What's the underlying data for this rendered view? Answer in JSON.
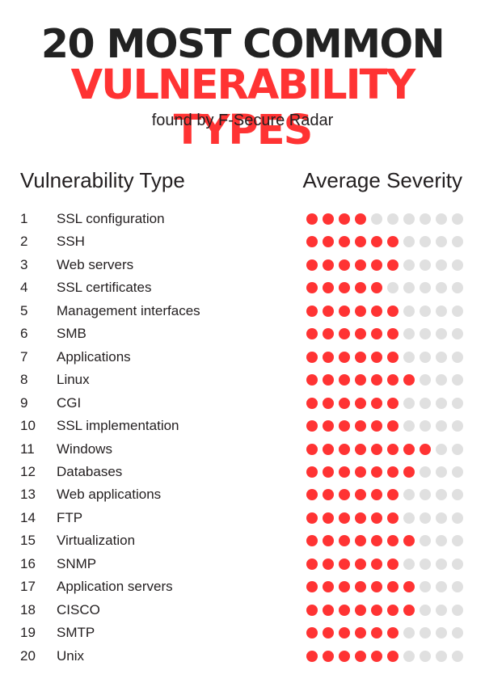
{
  "header": {
    "title_line1": "20 MOST COMMON",
    "title_line2": "VULNERABILITY TYPES",
    "subtitle": "found by F-Secure Radar"
  },
  "colors": {
    "accent": "#ff3333",
    "inactive": "#e0e0e0",
    "text": "#231f20"
  },
  "chart_data": {
    "type": "table",
    "title": "20 MOST COMMON VULNERABILITY TYPES",
    "subtitle": "found by F-Secure Radar",
    "columns": [
      "Vulnerability Type",
      "Average Severity"
    ],
    "scale_max": 10,
    "rows": [
      {
        "rank": "1",
        "type": "SSL configuration",
        "severity": 4
      },
      {
        "rank": "2",
        "type": "SSH",
        "severity": 6
      },
      {
        "rank": "3",
        "type": "Web servers",
        "severity": 6
      },
      {
        "rank": "4",
        "type": "SSL certificates",
        "severity": 5
      },
      {
        "rank": "5",
        "type": "Management interfaces",
        "severity": 6
      },
      {
        "rank": "6",
        "type": "SMB",
        "severity": 6
      },
      {
        "rank": "7",
        "type": "Applications",
        "severity": 6
      },
      {
        "rank": "8",
        "type": "Linux",
        "severity": 7
      },
      {
        "rank": "9",
        "type": "CGI",
        "severity": 6
      },
      {
        "rank": "10",
        "type": "SSL implementation",
        "severity": 6
      },
      {
        "rank": "11",
        "type": "Windows",
        "severity": 8
      },
      {
        "rank": "12",
        "type": "Databases",
        "severity": 7
      },
      {
        "rank": "13",
        "type": "Web applications",
        "severity": 6
      },
      {
        "rank": "14",
        "type": "FTP",
        "severity": 6
      },
      {
        "rank": "15",
        "type": "Virtualization",
        "severity": 7
      },
      {
        "rank": "16",
        "type": "SNMP",
        "severity": 6
      },
      {
        "rank": "17",
        "type": "Application servers",
        "severity": 7
      },
      {
        "rank": "18",
        "type": "CISCO",
        "severity": 7
      },
      {
        "rank": "19",
        "type": "SMTP",
        "severity": 6
      },
      {
        "rank": "20",
        "type": "Unix",
        "severity": 6
      }
    ]
  }
}
